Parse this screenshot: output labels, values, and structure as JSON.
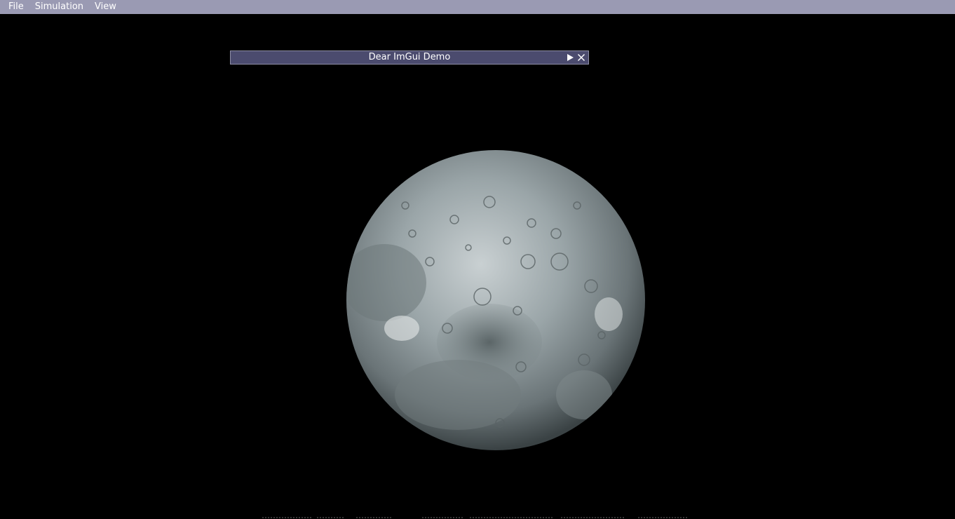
{
  "menubar": {
    "items": [
      {
        "label": "File"
      },
      {
        "label": "Simulation"
      },
      {
        "label": "View"
      }
    ]
  },
  "imgui_window": {
    "title": "Dear ImGui Demo",
    "collapse_icon": "play-triangle-icon",
    "close_icon": "close-icon"
  },
  "scene": {
    "object": "moon-globe",
    "background_color": "#000000"
  },
  "colors": {
    "menubar_bg": "#9a9ab3",
    "window_title_bg": "#4b4b6e",
    "window_border": "#8e8ea6"
  }
}
